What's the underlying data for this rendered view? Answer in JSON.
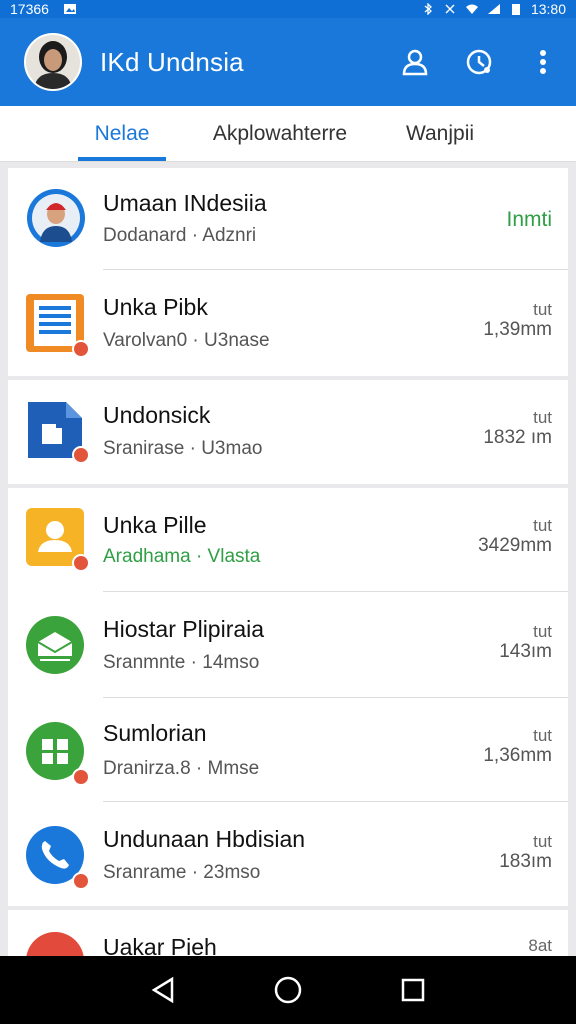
{
  "status_bar": {
    "left_text": "17366",
    "right_text": "13:80"
  },
  "app_bar": {
    "title": "IKd Undnsia",
    "actions": [
      "person-icon",
      "timer-icon",
      "more-vert-icon"
    ]
  },
  "tabs": [
    {
      "label": "Nelae",
      "active": true
    },
    {
      "label": "Akplowahterre",
      "active": false
    },
    {
      "label": "Wanjpii",
      "active": false
    }
  ],
  "rows": [
    {
      "title": "Umaan INdesiia",
      "subtitle": "Dodanard · Adznri",
      "status": "Inmti",
      "icon": "profile-avatar-icon"
    },
    {
      "title": "Unka Pibk",
      "subtitle": "Varolvan0 · U3nase",
      "meta_top": "tut",
      "meta_bottom": "1,39mm",
      "icon": "document-icon"
    },
    {
      "title": "Undonsick",
      "subtitle": "Sranirase · U3mao",
      "meta_top": "tut",
      "meta_bottom": "1832 ım",
      "icon": "file-icon"
    },
    {
      "title": "Unka Pille",
      "subtitle": "Aradhama · Vlasta",
      "meta_top": "tut",
      "meta_bottom": "3429mm",
      "icon": "contact-card-icon"
    },
    {
      "title": "Hiostar Plipiraia",
      "subtitle": "Sranmnte · 14mso",
      "meta_top": "tut",
      "meta_bottom": "143ım",
      "icon": "mail-stack-icon"
    },
    {
      "title": "Sumlorian",
      "subtitle": "Dranirza.8 · Mmse",
      "meta_top": "tut",
      "meta_bottom": "1,36mm",
      "icon": "grid-icon"
    },
    {
      "title": "Undunaan Hbdisian",
      "subtitle": "Sranrame · 23mso",
      "meta_top": "tut",
      "meta_bottom": "183ım",
      "icon": "phone-icon"
    },
    {
      "title": "Uakar Pieh",
      "subtitle": "",
      "meta_top": "8at",
      "meta_bottom": "",
      "icon": "red-app-icon"
    }
  ],
  "colors": {
    "primary": "#1a78da",
    "green": "#2f9e44",
    "badge": "#e2553b"
  }
}
